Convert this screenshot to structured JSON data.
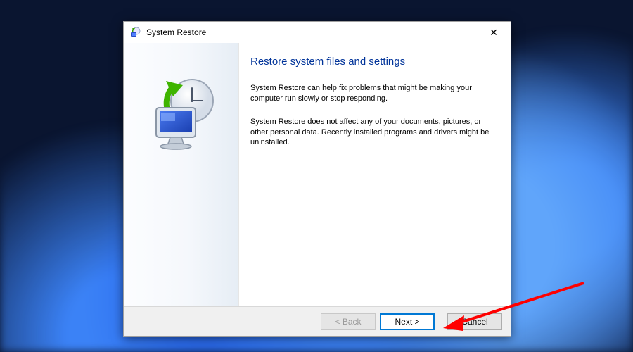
{
  "titlebar": {
    "title": "System Restore"
  },
  "main": {
    "heading": "Restore system files and settings",
    "paragraph1": "System Restore can help fix problems that might be making your computer run slowly or stop responding.",
    "paragraph2": "System Restore does not affect any of your documents, pictures, or other personal data. Recently installed programs and drivers might be uninstalled."
  },
  "footer": {
    "back_label": "< Back",
    "next_label": "Next >",
    "cancel_label": "Cancel"
  },
  "icons": {
    "app_icon": "system-restore-icon",
    "close_glyph": "✕"
  }
}
